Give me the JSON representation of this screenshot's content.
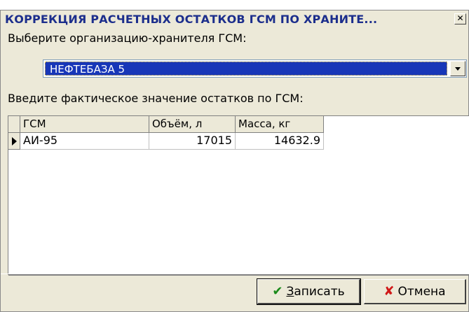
{
  "window": {
    "title": "КОРРЕКЦИЯ РАСЧЕТНЫХ ОСТАТКОВ ГСМ ПО ХРАНИТЕ...",
    "close_glyph": "✕"
  },
  "storage": {
    "label": "Выберите организацию-хранителя ГСМ:",
    "selected": "НЕФТЕБАЗА 5"
  },
  "grid": {
    "label": "Введите фактическое значение остатков по ГСМ:",
    "columns": [
      "ГСМ",
      "Объём, л",
      "Масса, кг"
    ],
    "rows": [
      {
        "fuel": "АИ-95",
        "volume": "17015",
        "mass": "14632.9"
      }
    ]
  },
  "buttons": {
    "save": "Записать",
    "cancel": "Отмена"
  },
  "icons": {
    "check": "✔",
    "cross": "✘"
  }
}
